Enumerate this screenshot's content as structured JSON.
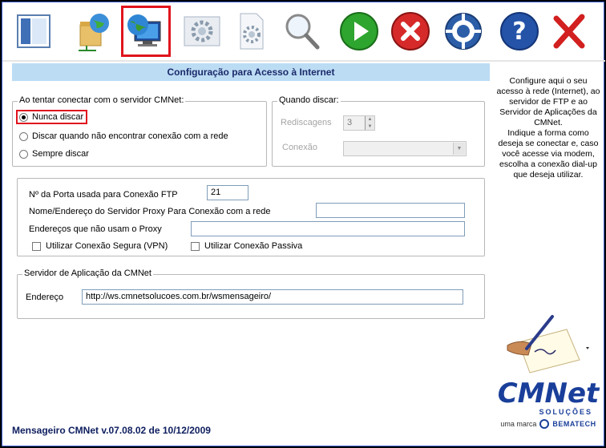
{
  "toolbar": {
    "items": [
      {
        "name": "window-icon"
      },
      {
        "name": "network-folder-icon"
      },
      {
        "name": "internet-globe-icon",
        "selected": true
      },
      {
        "name": "gear-icon"
      },
      {
        "name": "document-gear-icon"
      },
      {
        "name": "magnifier-icon"
      },
      {
        "name": "play-icon"
      },
      {
        "name": "cancel-icon"
      },
      {
        "name": "lifebuoy-icon"
      },
      {
        "name": "help-icon"
      },
      {
        "name": "close-icon"
      }
    ]
  },
  "panel": {
    "title": "Configuração para Acesso à Internet",
    "connect_group": {
      "label": "Ao tentar conectar com o servidor CMNet:",
      "options": [
        "Nunca discar",
        "Discar quando não encontrar conexão com a rede",
        "Sempre discar"
      ],
      "selected": 0
    },
    "dial_group": {
      "label": "Quando discar:",
      "redial_label": "Rediscagens",
      "redial_value": "3",
      "connection_label": "Conexão",
      "connection_value": ""
    },
    "ftp_group": {
      "port_label": "Nº da Porta usada para Conexão FTP",
      "port_value": "21",
      "proxy_label": "Nome/Endereço do Servidor Proxy Para Conexão com a rede",
      "proxy_value": "",
      "no_proxy_label": "Endereços  que não usam o Proxy",
      "no_proxy_value": "",
      "secure_label": "Utilizar Conexão Segura (VPN)",
      "secure_checked": false,
      "passive_label": "Utilizar Conexão Passiva",
      "passive_checked": false
    },
    "server_group": {
      "label": "Servidor de Aplicação da CMNet",
      "address_label": "Endereço",
      "address_value": "http://ws.cmnetsolucoes.com.br/wsmensageiro/"
    }
  },
  "help_text": "Configure aqui o seu acesso à rede (Internet), ao servidor de FTP e ao Servidor de Aplicações da CMNet.\nIndique a forma como deseja se conectar e, caso você acesse via modem, escolha a conexão dial-up que deseja utilizar.",
  "status": "Mensageiro CMNet v.07.08.02 de 10/12/2009",
  "logo": {
    "brand": "CMNet",
    "sub": "SOLUÇÕES",
    "tagline_prefix": "uma marca",
    "tagline_brand": "Bematech"
  },
  "colors": {
    "accent": "#bcdcf4",
    "selection": "#e0141e",
    "logo_blue": "#1a3f9a"
  }
}
